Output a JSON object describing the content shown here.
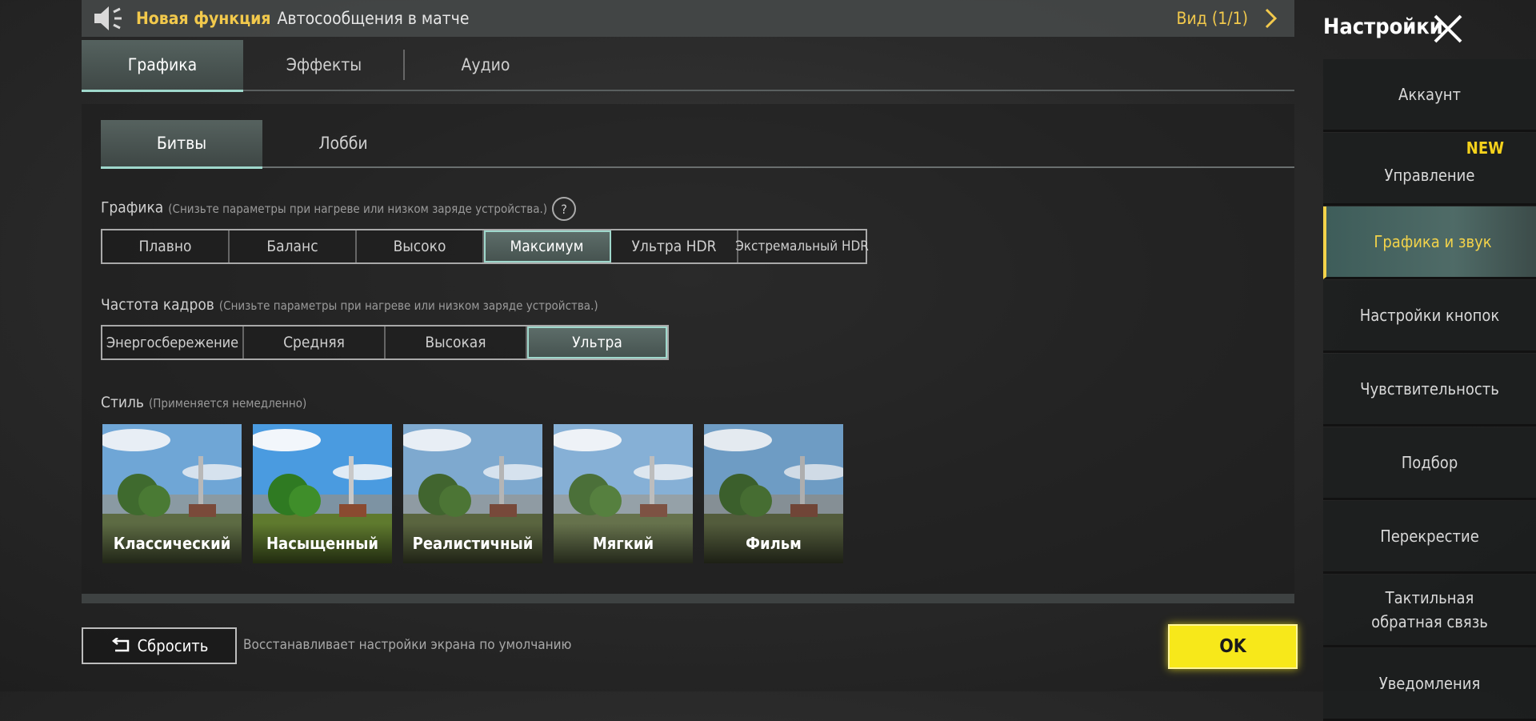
{
  "announcement": {
    "tag": "Новая функция",
    "text": "Автосообщения в матче",
    "view_label": "Вид (1/1)"
  },
  "main_tabs": [
    {
      "label": "Графика",
      "active": true
    },
    {
      "label": "Эффекты",
      "active": false
    },
    {
      "label": "Аудио",
      "active": false
    }
  ],
  "sub_tabs": [
    {
      "label": "Битвы",
      "active": true
    },
    {
      "label": "Лобби",
      "active": false
    }
  ],
  "graphics": {
    "label": "Графика",
    "note": "(Снизьте параметры при нагреве или низком заряде устройства.)",
    "options": [
      "Плавно",
      "Баланс",
      "Высоко",
      "Максимум",
      "Ультра HDR",
      "Экстремальный HDR"
    ],
    "selected": "Максимум"
  },
  "framerate": {
    "label": "Частота кадров",
    "note": "(Снизьте параметры при нагреве или низком заряде устройства.)",
    "options": [
      "Энергосбережение",
      "Средняя",
      "Высокая",
      "Ультра"
    ],
    "selected": "Ультра"
  },
  "style": {
    "label": "Стиль",
    "note": "(Применяется немедленно)",
    "options": [
      "Классический",
      "Насыщенный",
      "Реалистичный",
      "Мягкий",
      "Фильм"
    ],
    "selected": "Насыщенный"
  },
  "footer": {
    "reset_label": "Сбросить",
    "reset_desc": "Восстанавливает настройки экрана по умолчанию",
    "ok_label": "OK"
  },
  "sidebar": {
    "title": "Настройки",
    "items": [
      {
        "label": "Аккаунт"
      },
      {
        "label": "Управление",
        "badge": "NEW"
      },
      {
        "label": "Графика и звук",
        "active": true
      },
      {
        "label": "Настройки кнопок"
      },
      {
        "label": "Чувствительность"
      },
      {
        "label": "Подбор"
      },
      {
        "label": "Перекрестие"
      },
      {
        "label": "Тактильная обратная связь"
      },
      {
        "label": "Уведомления"
      }
    ]
  },
  "colors": {
    "accent_yellow": "#f5d21c",
    "accent_teal": "#9fd8cc"
  },
  "icons": [
    "speaker-icon",
    "chevron-right-icon",
    "help-icon",
    "reset-arrow-icon",
    "close-icon"
  ]
}
